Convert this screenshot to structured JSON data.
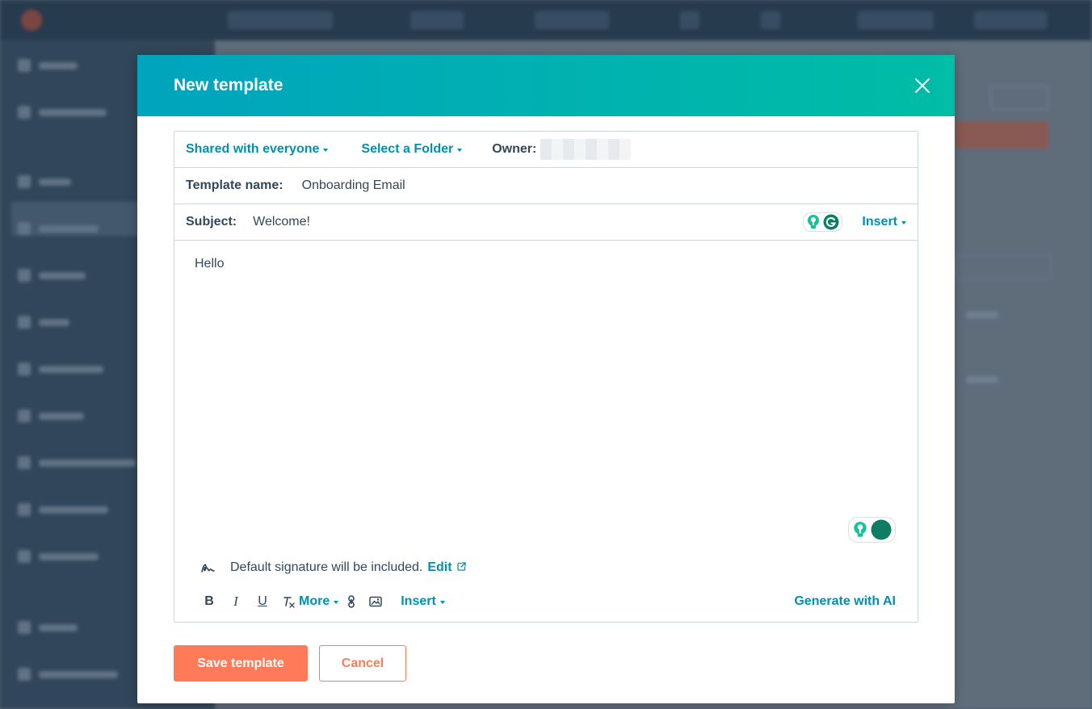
{
  "modal": {
    "title": "New template",
    "sharing_label": "Shared with everyone",
    "folder_label": "Select a Folder",
    "owner_label": "Owner:",
    "template_name_label": "Template name:",
    "template_name_value": "Onboarding Email",
    "subject_label": "Subject:",
    "subject_value": "Welcome!",
    "subject_insert_label": "Insert",
    "body_text": "Hello",
    "signature_text": "Default signature will be included.",
    "signature_edit_label": "Edit",
    "toolbar": {
      "bold": "B",
      "italic": "I",
      "underline": "U",
      "more_label": "More",
      "insert_label": "Insert",
      "generate_label": "Generate with AI"
    },
    "save_label": "Save template",
    "cancel_label": "Cancel"
  },
  "colors": {
    "header_gradient_start": "#00a4bd",
    "header_gradient_end": "#00bda5",
    "link": "#0091ae",
    "primary_button": "#ff7a59",
    "text": "#33475b",
    "border": "#cbd6e2",
    "grammarly": "#15c39a"
  },
  "icons": [
    "close-icon",
    "grammarly-icon",
    "lightbulb-icon",
    "signature-icon",
    "external-link-icon",
    "bold-icon",
    "italic-icon",
    "underline-icon",
    "clear-format-icon",
    "link-icon",
    "image-icon"
  ]
}
